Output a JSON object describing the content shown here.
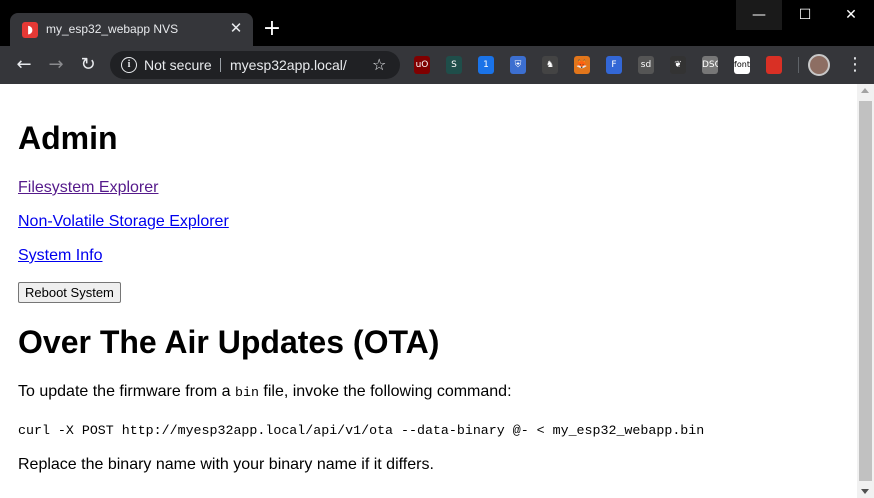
{
  "browser": {
    "tab_title": "my_esp32_webapp NVS",
    "tab_close": "✕",
    "new_tab": "+",
    "security_label": "Not secure",
    "url": "myesp32app.local/",
    "window_controls": {
      "minimize": "—",
      "maximize": "☐",
      "close": "✕"
    },
    "extensions": [
      {
        "name": "ublock",
        "label": "uO",
        "color": "#800000"
      },
      {
        "name": "stylus",
        "label": "S",
        "color": "#1f4e4a"
      },
      {
        "name": "onepassword",
        "label": "1",
        "color": "#1a73e8"
      },
      {
        "name": "bitwarden",
        "label": "⛨",
        "color": "#3c6fd0"
      },
      {
        "name": "ghost-ext",
        "label": "♞",
        "color": "#444"
      },
      {
        "name": "metamask",
        "label": "🦊",
        "color": "#e2761b"
      },
      {
        "name": "f-ext",
        "label": "F",
        "color": "#3367d6"
      },
      {
        "name": "std-ext",
        "label": "sd",
        "color": "#555"
      },
      {
        "name": "feather-ext",
        "label": "❦",
        "color": "#333"
      },
      {
        "name": "dsc-ext",
        "label": "DSC",
        "color": "#777"
      },
      {
        "name": "font-ext",
        "label": "font",
        "color": "#fff"
      },
      {
        "name": "color-ext",
        "label": "",
        "color": "#d93025"
      }
    ]
  },
  "page": {
    "heading_admin": "Admin",
    "links": {
      "filesystem": "Filesystem Explorer",
      "nvs": "Non-Volatile Storage Explorer",
      "sysinfo": "System Info"
    },
    "reboot_button": "Reboot System",
    "heading_ota": "Over The Air Updates (OTA)",
    "ota_intro_before": "To update the firmware from a ",
    "ota_intro_code": "bin",
    "ota_intro_after": " file, invoke the following command:",
    "ota_command": "curl -X POST http://myesp32app.local/api/v1/ota --data-binary @- < my_esp32_webapp.bin",
    "ota_note": "Replace the binary name with your binary name if it differs."
  }
}
